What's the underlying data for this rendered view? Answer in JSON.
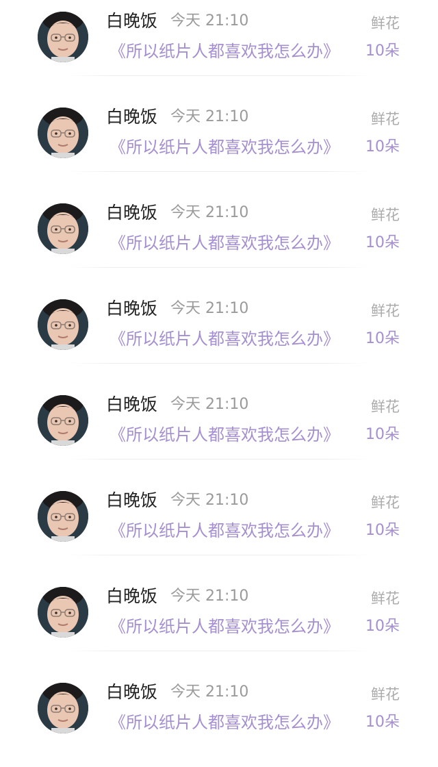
{
  "items": [
    {
      "name": "白晚饭",
      "time": "今天 21:10",
      "title": "《所以纸片人都喜欢我怎么办》",
      "gift_label": "鲜花",
      "gift_count": "10朵",
      "avatar_icon": "user-avatar-icon"
    },
    {
      "name": "白晚饭",
      "time": "今天 21:10",
      "title": "《所以纸片人都喜欢我怎么办》",
      "gift_label": "鲜花",
      "gift_count": "10朵",
      "avatar_icon": "user-avatar-icon"
    },
    {
      "name": "白晚饭",
      "time": "今天 21:10",
      "title": "《所以纸片人都喜欢我怎么办》",
      "gift_label": "鲜花",
      "gift_count": "10朵",
      "avatar_icon": "user-avatar-icon"
    },
    {
      "name": "白晚饭",
      "time": "今天 21:10",
      "title": "《所以纸片人都喜欢我怎么办》",
      "gift_label": "鲜花",
      "gift_count": "10朵",
      "avatar_icon": "user-avatar-icon"
    },
    {
      "name": "白晚饭",
      "time": "今天 21:10",
      "title": "《所以纸片人都喜欢我怎么办》",
      "gift_label": "鲜花",
      "gift_count": "10朵",
      "avatar_icon": "user-avatar-icon"
    },
    {
      "name": "白晚饭",
      "time": "今天 21:10",
      "title": "《所以纸片人都喜欢我怎么办》",
      "gift_label": "鲜花",
      "gift_count": "10朵",
      "avatar_icon": "user-avatar-icon"
    },
    {
      "name": "白晚饭",
      "time": "今天 21:10",
      "title": "《所以纸片人都喜欢我怎么办》",
      "gift_label": "鲜花",
      "gift_count": "10朵",
      "avatar_icon": "user-avatar-icon"
    },
    {
      "name": "白晚饭",
      "time": "今天 21:10",
      "title": "《所以纸片人都喜欢我怎么办》",
      "gift_label": "鲜花",
      "gift_count": "10朵",
      "avatar_icon": "user-avatar-icon"
    }
  ],
  "colors": {
    "name_text": "#222222",
    "meta_text": "#9a9a9a",
    "accent_purple": "#a58fd0",
    "page_background": "#ffffff"
  }
}
